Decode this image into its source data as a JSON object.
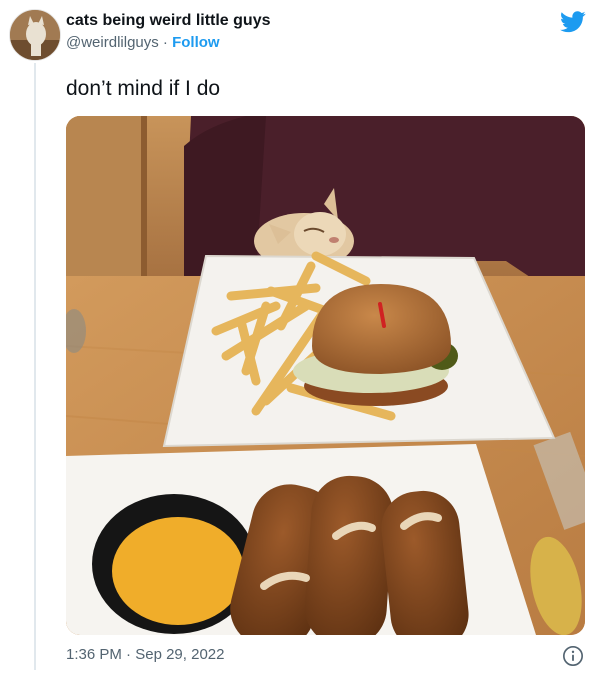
{
  "user": {
    "display_name": "cats being weird little guys",
    "handle": "@weirdlilguys",
    "separator": " · ",
    "follow_label": "Follow"
  },
  "tweet": {
    "text": "don’t mind if I do",
    "time": "1:36 PM",
    "meta_separator": " · ",
    "date": "Sep 29, 2022"
  },
  "icons": {
    "brand": "twitter-bird-icon",
    "info": "info-icon"
  },
  "colors": {
    "link": "#1d9bf0",
    "secondary_text": "#536471",
    "primary_text": "#0f1419"
  }
}
